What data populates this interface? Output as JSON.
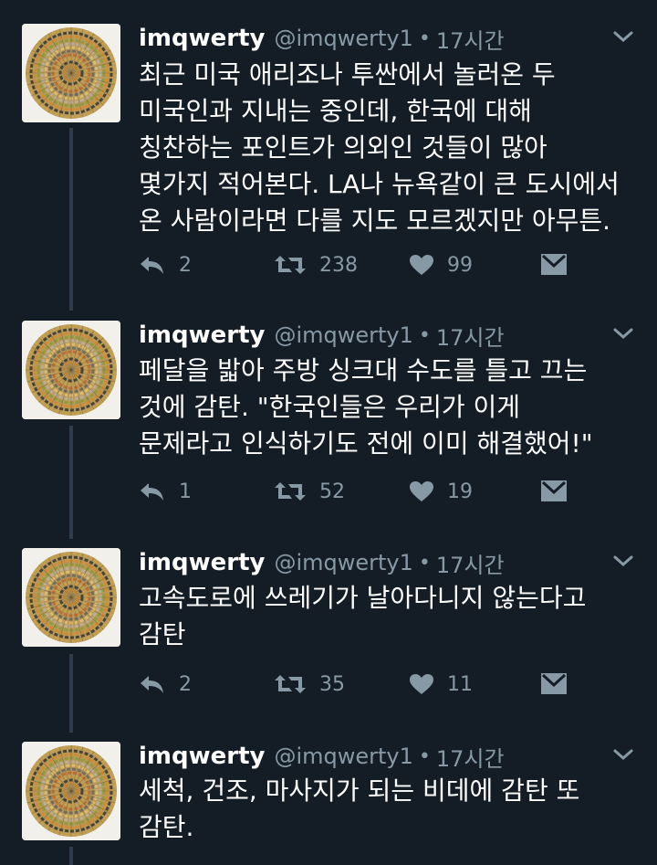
{
  "tweets": [
    {
      "name": "imqwerty",
      "handle": "@imqwerty1",
      "dot": "•",
      "time": "17시간",
      "text": "최근 미국 애리조나 투싼에서 놀러온 두\n미국인과 지내는 중인데, 한국에 대해\n칭찬하는 포인트가 의외인 것들이 많아\n몇가지 적어본다. LA나 뉴욕같이 큰 도시에서\n온 사람이라면 다를 지도 모르겠지만 아무튼.",
      "replies": "2",
      "retweets": "238",
      "likes": "99"
    },
    {
      "name": "imqwerty",
      "handle": "@imqwerty1",
      "dot": "•",
      "time": "17시간",
      "text": "페달을 밟아 주방 싱크대 수도를 틀고 끄는\n것에 감탄. \"한국인들은 우리가 이게\n문제라고 인식하기도 전에 이미 해결했어!\"",
      "replies": "1",
      "retweets": "52",
      "likes": "19"
    },
    {
      "name": "imqwerty",
      "handle": "@imqwerty1",
      "dot": "•",
      "time": "17시간",
      "text": "고속도로에 쓰레기가 날아다니지 않는다고\n감탄",
      "replies": "2",
      "retweets": "35",
      "likes": "11"
    },
    {
      "name": "imqwerty",
      "handle": "@imqwerty1",
      "dot": "•",
      "time": "17시간",
      "text": "세척, 건조, 마사지가 되는 비데에 감탄 또\n감탄.",
      "replies": "",
      "retweets": "",
      "likes": ""
    }
  ],
  "icons": {
    "reply": "reply-icon",
    "retweet": "retweet-icon",
    "like": "heart-icon",
    "dm": "envelope-icon",
    "more": "chevron-down-icon",
    "avatar": "woven-basket-avatar"
  },
  "colors": {
    "background": "#141d26",
    "secondary_text": "#8899a6",
    "thread_line": "#2f3d4b"
  }
}
